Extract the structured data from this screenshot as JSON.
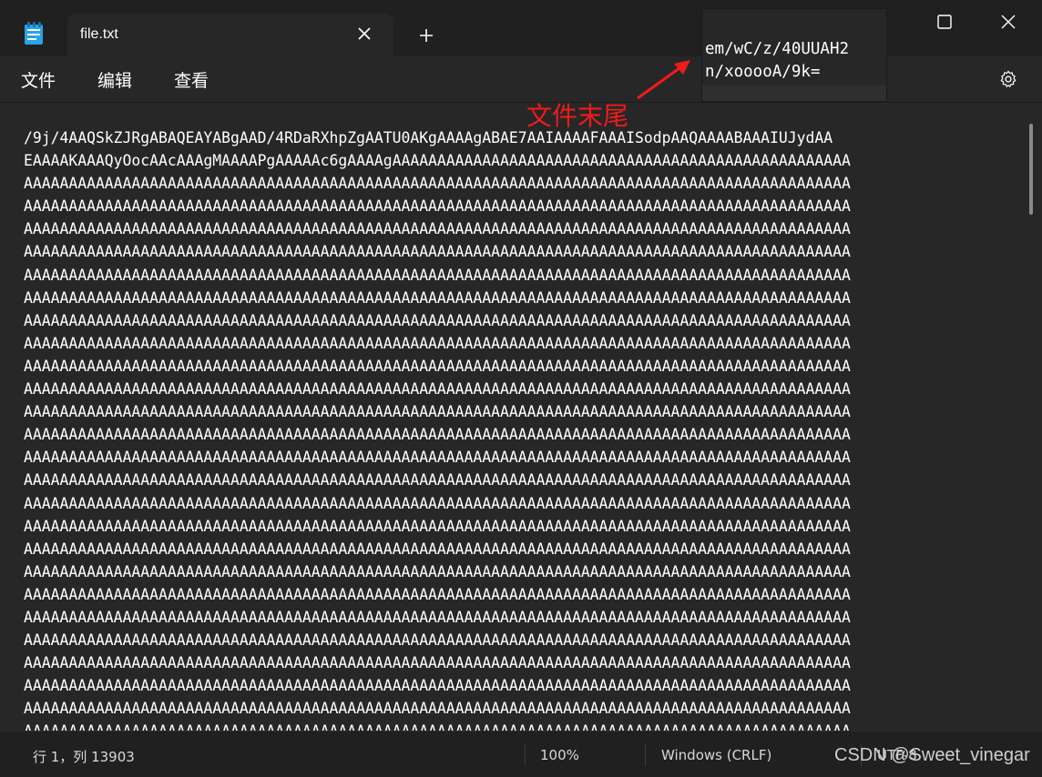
{
  "window": {
    "tab_title": "file.txt",
    "icons": {
      "app": "notepad-icon",
      "tab_close": "close-icon",
      "new_tab": "plus-icon",
      "settings": "gear-icon"
    }
  },
  "menu": {
    "file": "文件",
    "edit": "编辑",
    "view": "查看"
  },
  "editor": {
    "lines": [
      "/9j/4AAQSkZJRgABAQEAYABgAAD/4RDaRXhpZgAATU0AKgAAAAgABAE7AAIAAAAFAAAISodpAAQAAAABAAAIUJydAA",
      "EAAAAKAAAQyOocAAcAAAgMAAAAPgAAAAAc6gAAAAgAAAAAAAAAAAAAAAAAAAAAAAAAAAAAAAAAAAAAAAAAAAAAAAAAAA",
      "AAAAAAAAAAAAAAAAAAAAAAAAAAAAAAAAAAAAAAAAAAAAAAAAAAAAAAAAAAAAAAAAAAAAAAAAAAAAAAAAAAAAAAAAAAAA",
      "AAAAAAAAAAAAAAAAAAAAAAAAAAAAAAAAAAAAAAAAAAAAAAAAAAAAAAAAAAAAAAAAAAAAAAAAAAAAAAAAAAAAAAAAAAAA",
      "AAAAAAAAAAAAAAAAAAAAAAAAAAAAAAAAAAAAAAAAAAAAAAAAAAAAAAAAAAAAAAAAAAAAAAAAAAAAAAAAAAAAAAAAAAAA",
      "AAAAAAAAAAAAAAAAAAAAAAAAAAAAAAAAAAAAAAAAAAAAAAAAAAAAAAAAAAAAAAAAAAAAAAAAAAAAAAAAAAAAAAAAAAAA",
      "AAAAAAAAAAAAAAAAAAAAAAAAAAAAAAAAAAAAAAAAAAAAAAAAAAAAAAAAAAAAAAAAAAAAAAAAAAAAAAAAAAAAAAAAAAAA",
      "AAAAAAAAAAAAAAAAAAAAAAAAAAAAAAAAAAAAAAAAAAAAAAAAAAAAAAAAAAAAAAAAAAAAAAAAAAAAAAAAAAAAAAAAAAAA",
      "AAAAAAAAAAAAAAAAAAAAAAAAAAAAAAAAAAAAAAAAAAAAAAAAAAAAAAAAAAAAAAAAAAAAAAAAAAAAAAAAAAAAAAAAAAAA",
      "AAAAAAAAAAAAAAAAAAAAAAAAAAAAAAAAAAAAAAAAAAAAAAAAAAAAAAAAAAAAAAAAAAAAAAAAAAAAAAAAAAAAAAAAAAAA",
      "AAAAAAAAAAAAAAAAAAAAAAAAAAAAAAAAAAAAAAAAAAAAAAAAAAAAAAAAAAAAAAAAAAAAAAAAAAAAAAAAAAAAAAAAAAAA",
      "AAAAAAAAAAAAAAAAAAAAAAAAAAAAAAAAAAAAAAAAAAAAAAAAAAAAAAAAAAAAAAAAAAAAAAAAAAAAAAAAAAAAAAAAAAAA",
      "AAAAAAAAAAAAAAAAAAAAAAAAAAAAAAAAAAAAAAAAAAAAAAAAAAAAAAAAAAAAAAAAAAAAAAAAAAAAAAAAAAAAAAAAAAAA",
      "AAAAAAAAAAAAAAAAAAAAAAAAAAAAAAAAAAAAAAAAAAAAAAAAAAAAAAAAAAAAAAAAAAAAAAAAAAAAAAAAAAAAAAAAAAAA",
      "AAAAAAAAAAAAAAAAAAAAAAAAAAAAAAAAAAAAAAAAAAAAAAAAAAAAAAAAAAAAAAAAAAAAAAAAAAAAAAAAAAAAAAAAAAAA",
      "AAAAAAAAAAAAAAAAAAAAAAAAAAAAAAAAAAAAAAAAAAAAAAAAAAAAAAAAAAAAAAAAAAAAAAAAAAAAAAAAAAAAAAAAAAAA",
      "AAAAAAAAAAAAAAAAAAAAAAAAAAAAAAAAAAAAAAAAAAAAAAAAAAAAAAAAAAAAAAAAAAAAAAAAAAAAAAAAAAAAAAAAAAAA",
      "AAAAAAAAAAAAAAAAAAAAAAAAAAAAAAAAAAAAAAAAAAAAAAAAAAAAAAAAAAAAAAAAAAAAAAAAAAAAAAAAAAAAAAAAAAAA",
      "AAAAAAAAAAAAAAAAAAAAAAAAAAAAAAAAAAAAAAAAAAAAAAAAAAAAAAAAAAAAAAAAAAAAAAAAAAAAAAAAAAAAAAAAAAAA",
      "AAAAAAAAAAAAAAAAAAAAAAAAAAAAAAAAAAAAAAAAAAAAAAAAAAAAAAAAAAAAAAAAAAAAAAAAAAAAAAAAAAAAAAAAAAAA",
      "AAAAAAAAAAAAAAAAAAAAAAAAAAAAAAAAAAAAAAAAAAAAAAAAAAAAAAAAAAAAAAAAAAAAAAAAAAAAAAAAAAAAAAAAAAAA",
      "AAAAAAAAAAAAAAAAAAAAAAAAAAAAAAAAAAAAAAAAAAAAAAAAAAAAAAAAAAAAAAAAAAAAAAAAAAAAAAAAAAAAAAAAAAAA",
      "AAAAAAAAAAAAAAAAAAAAAAAAAAAAAAAAAAAAAAAAAAAAAAAAAAAAAAAAAAAAAAAAAAAAAAAAAAAAAAAAAAAAAAAAAAAA",
      "AAAAAAAAAAAAAAAAAAAAAAAAAAAAAAAAAAAAAAAAAAAAAAAAAAAAAAAAAAAAAAAAAAAAAAAAAAAAAAAAAAAAAAAAAAAA",
      "AAAAAAAAAAAAAAAAAAAAAAAAAAAAAAAAAAAAAAAAAAAAAAAAAAAAAAAAAAAAAAAAAAAAAAAAAAAAAAAAAAAAAAAAAAAA",
      "AAAAAAAAAAAAAAAAAAAAAAAAAAAAAAAAAAAAAAAAAAAAAAAAAAAAAAAAAAAAAAAAAAAAAAAAAAAAAAAAAAAAAAAAAAAA",
      "AAAAAAAAAAAAAAAAAAAAAAAAAAAAAAAAAAAAAAAAAAAAAAAAAAAAAAAAAAAAAAAAAAAAAAAAAAAAAAAAAAAAAAAAAAAA"
    ]
  },
  "status": {
    "position": "行 1，列 13903",
    "zoom": "100%",
    "line_ending": "Windows (CRLF)",
    "encoding": "UTF-8"
  },
  "annotation": {
    "zoom_lines": [
      "em/wC/z/40UUAH2",
      "n/xooooA/9k="
    ],
    "label": "文件末尾",
    "color": "#f11b1b"
  },
  "watermark": "CSDN @Sweet_vinegar"
}
